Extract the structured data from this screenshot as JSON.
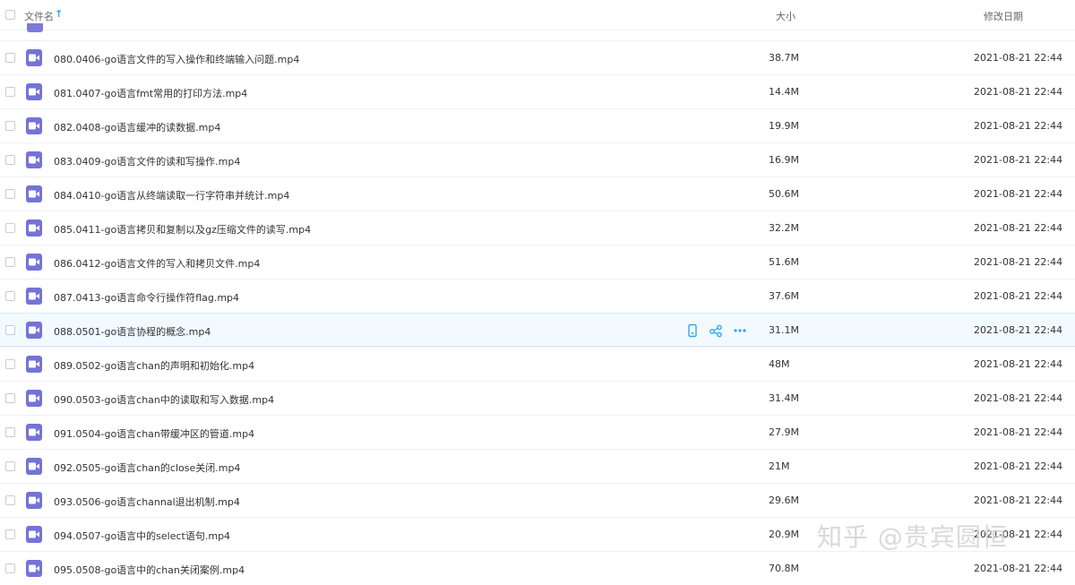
{
  "header": {
    "name_label": "文件名",
    "sort_arrow": "↑",
    "size_label": "大小",
    "date_label": "修改日期"
  },
  "files": [
    {
      "name": "080.0406-go语言文件的写入操作和终端输入问题.mp4",
      "size": "38.7M",
      "date": "2021-08-21 22:44"
    },
    {
      "name": "081.0407-go语言fmt常用的打印方法.mp4",
      "size": "14.4M",
      "date": "2021-08-21 22:44"
    },
    {
      "name": "082.0408-go语言缓冲的读数据.mp4",
      "size": "19.9M",
      "date": "2021-08-21 22:44"
    },
    {
      "name": "083.0409-go语言文件的读和写操作.mp4",
      "size": "16.9M",
      "date": "2021-08-21 22:44"
    },
    {
      "name": "084.0410-go语言从终端读取一行字符串并统计.mp4",
      "size": "50.6M",
      "date": "2021-08-21 22:44"
    },
    {
      "name": "085.0411-go语言拷贝和复制以及gz压缩文件的读写.mp4",
      "size": "32.2M",
      "date": "2021-08-21 22:44"
    },
    {
      "name": "086.0412-go语言文件的写入和拷贝文件.mp4",
      "size": "51.6M",
      "date": "2021-08-21 22:44"
    },
    {
      "name": "087.0413-go语言命令行操作符flag.mp4",
      "size": "37.6M",
      "date": "2021-08-21 22:44"
    },
    {
      "name": "088.0501-go语言协程的概念.mp4",
      "size": "31.1M",
      "date": "2021-08-21 22:44"
    },
    {
      "name": "089.0502-go语言chan的声明和初始化.mp4",
      "size": "48M",
      "date": "2021-08-21 22:44"
    },
    {
      "name": "090.0503-go语言chan中的读取和写入数据.mp4",
      "size": "31.4M",
      "date": "2021-08-21 22:44"
    },
    {
      "name": "091.0504-go语言chan带缓冲区的管道.mp4",
      "size": "27.9M",
      "date": "2021-08-21 22:44"
    },
    {
      "name": "092.0505-go语言chan的close关闭.mp4",
      "size": "21M",
      "date": "2021-08-21 22:44"
    },
    {
      "name": "093.0506-go语言channal退出机制.mp4",
      "size": "29.6M",
      "date": "2021-08-21 22:44"
    },
    {
      "name": "094.0507-go语言中的select语句.mp4",
      "size": "20.9M",
      "date": "2021-08-21 22:44"
    },
    {
      "name": "095.0508-go语言中的chan关闭案例.mp4",
      "size": "70.8M",
      "date": "2021-08-21 22:44"
    }
  ],
  "active_row_index": 8,
  "row_actions": [
    "phone-icon",
    "share-icon",
    "more-icon"
  ],
  "file_icon": "video-file-icon",
  "colors": {
    "accent": "#2ea6f8",
    "file_icon": "#7473d7",
    "active_row_bg": "#f2faff"
  },
  "watermark": "知乎 @贵宾圆恒"
}
